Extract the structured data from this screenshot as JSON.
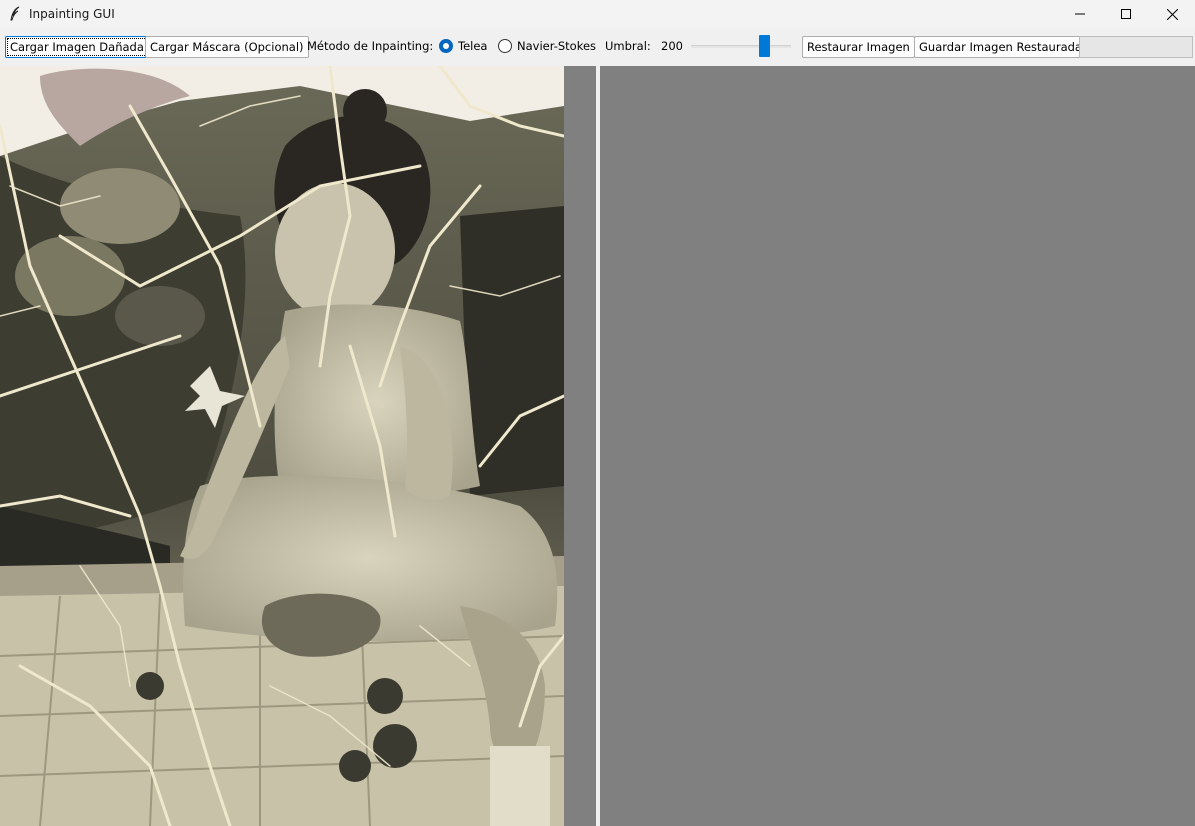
{
  "window": {
    "title": "Inpainting GUI",
    "icon": "feather-icon"
  },
  "toolbar": {
    "load_damaged_label": "Cargar Imagen Dañada",
    "load_mask_label": "Cargar Máscara (Opcional)",
    "method_label": "Método de Inpainting:",
    "methods": [
      {
        "label": "Telea",
        "selected": true
      },
      {
        "label": "Navier-Stokes",
        "selected": false
      }
    ],
    "threshold_label": "Umbral:",
    "threshold_value": "200",
    "threshold_slider_fraction": 0.78,
    "restore_label": "Restaurar Imagen",
    "save_label": "Guardar Imagen Restaurada",
    "progress_fraction": 0
  },
  "canvases": {
    "left": {
      "content": "damaged-photo",
      "background": "#808080"
    },
    "right": {
      "content": "empty",
      "background": "#808080"
    }
  },
  "colors": {
    "accent": "#0078d7",
    "canvas_bg": "#808080",
    "photo_tone": "#e9e2c3"
  }
}
